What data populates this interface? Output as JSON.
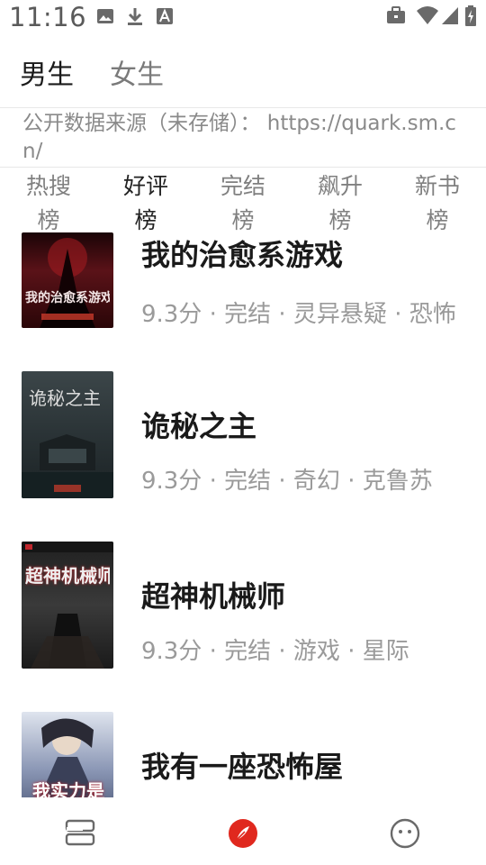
{
  "status_bar": {
    "time": "11:16",
    "icons": [
      "image-icon",
      "download-icon",
      "a-icon"
    ],
    "right_icons": [
      "briefcase-icon",
      "wifi-icon",
      "signal-icon",
      "battery-icon"
    ]
  },
  "gender_tabs": [
    {
      "label": "男生",
      "active": true
    },
    {
      "label": "女生",
      "active": false
    }
  ],
  "source_text": "公开数据来源（未存储）： https://quark.sm.cn/",
  "rank_tabs": [
    {
      "label": "热搜榜",
      "active": false
    },
    {
      "label": "好评榜",
      "active": true
    },
    {
      "label": "完结榜",
      "active": false
    },
    {
      "label": "飙升榜",
      "active": false
    },
    {
      "label": "新书榜",
      "active": false
    }
  ],
  "books": [
    {
      "title": "我的治愈系游戏",
      "meta": "9.3分 · 完结 · 灵异悬疑 · 恐怖",
      "cover_text": "我的治愈系游戏",
      "cover_color": "#3a0d10"
    },
    {
      "title": "诡秘之主",
      "meta": "9.3分 · 完结 · 奇幻 · 克鲁苏",
      "cover_text": "诡秘之主",
      "cover_color": "#2a3336"
    },
    {
      "title": "超神机械师",
      "meta": "9.3分 · 完结 · 游戏 · 星际",
      "cover_text": "超神机械师",
      "cover_color": "#2b2b2b"
    },
    {
      "title": "我有一座恐怖屋",
      "meta": "",
      "cover_text": "我实力是",
      "cover_color": "#3a4a6a"
    }
  ],
  "accent_color": "#e0281e"
}
